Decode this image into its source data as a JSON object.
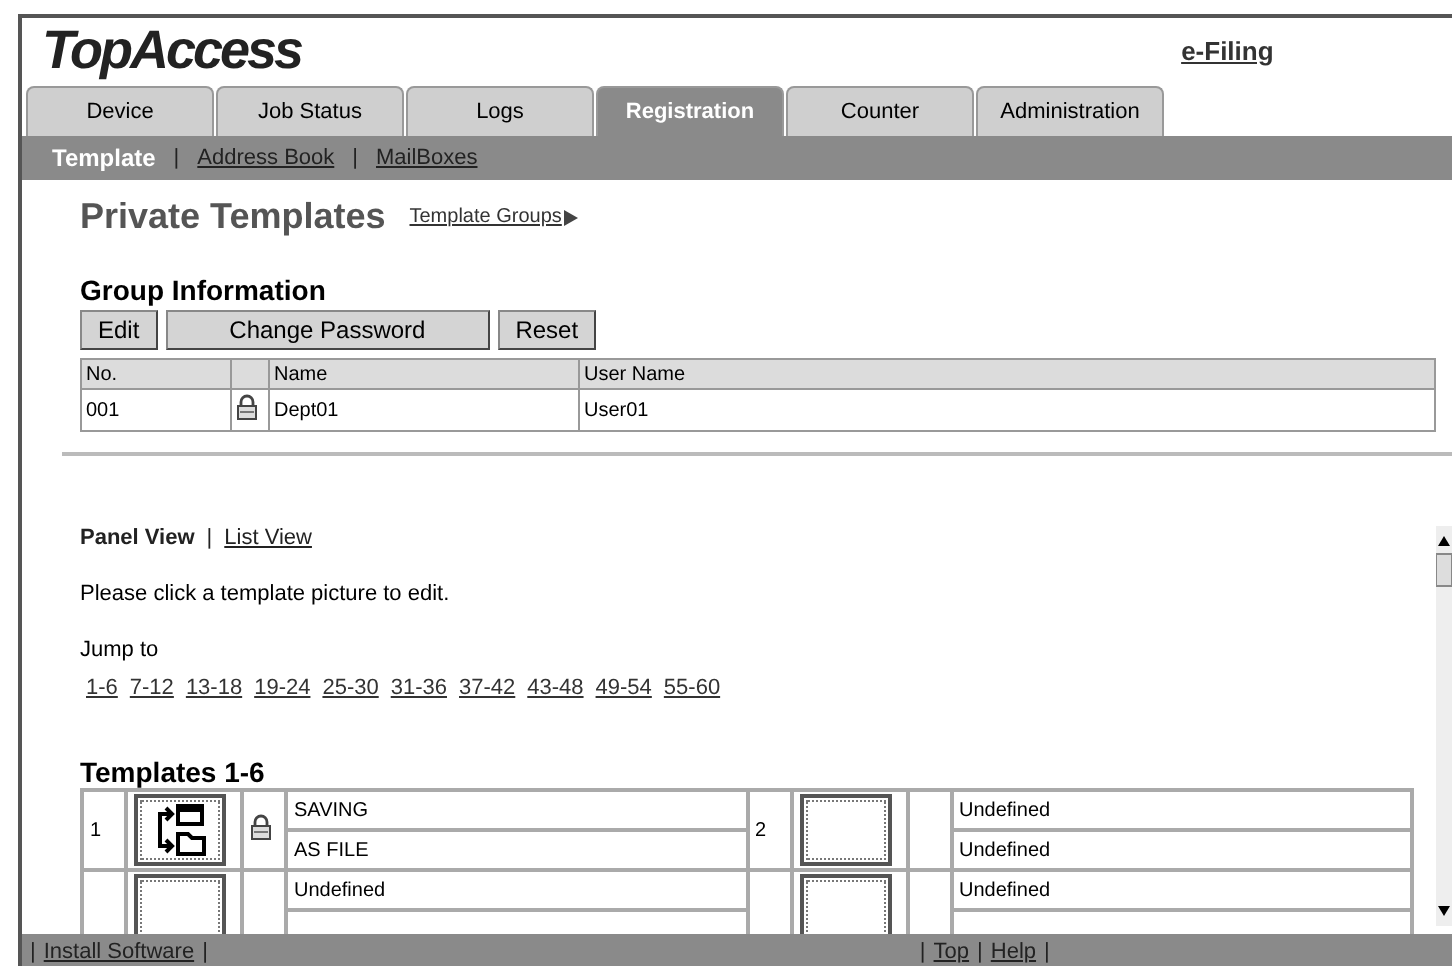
{
  "header": {
    "logo": "TopAccess",
    "link": "e-Filing"
  },
  "tabs": [
    {
      "label": "Device",
      "selected": false
    },
    {
      "label": "Job Status",
      "selected": false
    },
    {
      "label": "Logs",
      "selected": false
    },
    {
      "label": "Registration",
      "selected": true
    },
    {
      "label": "Counter",
      "selected": false
    },
    {
      "label": "Administration",
      "selected": false
    }
  ],
  "subnav": [
    {
      "label": "Template",
      "selected": true
    },
    {
      "label": "Address Book",
      "selected": false
    },
    {
      "label": "MailBoxes",
      "selected": false
    }
  ],
  "subnav_separator": "|",
  "page_title": "Private Templates",
  "title_link": "Template Groups",
  "group": {
    "heading": "Group Information",
    "buttons": [
      "Edit",
      "Change Password",
      "Reset"
    ],
    "columns": [
      "No.",
      "",
      "Name",
      "User Name"
    ],
    "rows": [
      {
        "no": "001",
        "locked": true,
        "name": "Dept01",
        "user": "User01"
      }
    ]
  },
  "views": [
    {
      "label": "Panel View",
      "selected": true
    },
    {
      "label": "List View",
      "selected": false
    }
  ],
  "instruction": "Please click a template picture to edit.",
  "jump_label": "Jump to",
  "jump_links": [
    "1-6",
    "7-12",
    "13-18",
    "19-24",
    "25-30",
    "31-36",
    "37-42",
    "43-48",
    "49-54",
    "55-60"
  ],
  "templates_heading": "Templates 1-6",
  "templates": [
    {
      "number": "1",
      "has_icon": true,
      "locked": true,
      "lines": [
        "SAVING",
        "AS FILE"
      ]
    },
    {
      "number": "2",
      "has_icon": false,
      "locked": false,
      "lines": [
        "Undefined",
        "Undefined"
      ]
    },
    {
      "has_icon": false,
      "locked": false,
      "lines": [
        "Undefined"
      ]
    },
    {
      "has_icon": false,
      "locked": false,
      "lines": [
        "Undefined"
      ]
    }
  ],
  "footer": {
    "left": [
      "Install Software"
    ],
    "right": [
      "Top",
      "Help"
    ],
    "separator": "|"
  }
}
